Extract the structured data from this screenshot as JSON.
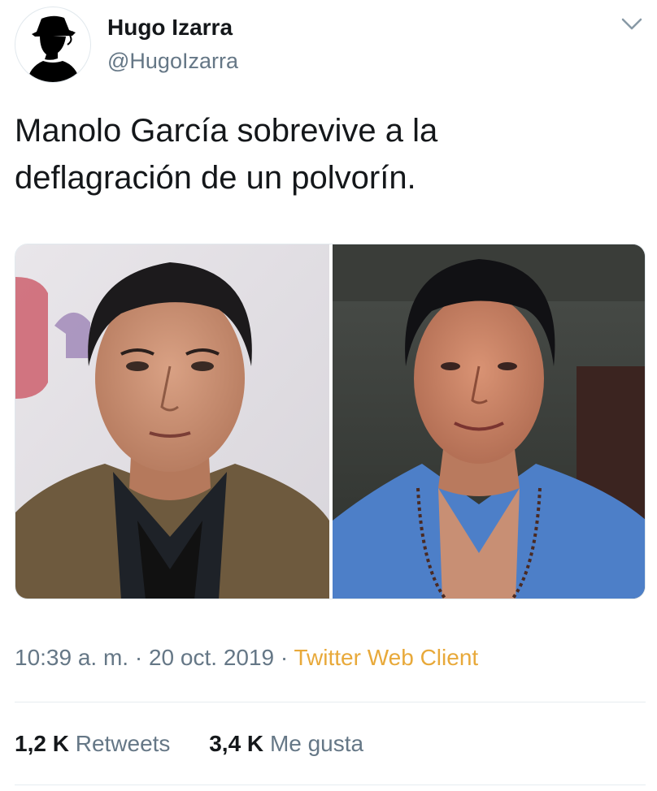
{
  "user": {
    "name": "Hugo Izarra",
    "handle": "@HugoIzarra",
    "avatar_icon": "silhouette-avatar-icon"
  },
  "menu": {
    "icon": "chevron-down-icon"
  },
  "tweet": {
    "line1": "Manolo García sobrevive a la",
    "line2": "deflagración de un polvorín."
  },
  "media": {
    "left_photo": "portrait-photo",
    "right_photo": "portrait-photo"
  },
  "meta": {
    "time": "10:39 a. m.",
    "sep1": " · ",
    "date": "20 oct. 2019",
    "sep2": " · ",
    "source": "Twitter Web Client",
    "source_color": "#e8a93a"
  },
  "stats": {
    "retweets_count": "1,2 K",
    "retweets_label": "Retweets",
    "likes_count": "3,4 K",
    "likes_label": "Me gusta"
  }
}
